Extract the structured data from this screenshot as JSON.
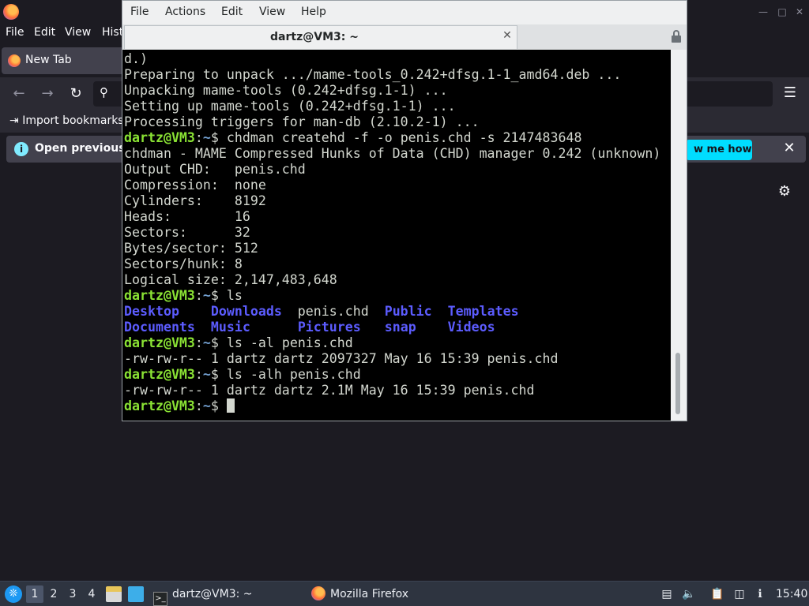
{
  "firefox": {
    "menu": [
      "File",
      "Edit",
      "View",
      "Hist"
    ],
    "tab_label": "New Tab",
    "bookmark_label": "Import bookmarks",
    "infobar_text": "Open previous",
    "infobar_button": "w me how"
  },
  "terminal": {
    "menu": [
      "File",
      "Actions",
      "Edit",
      "View",
      "Help"
    ],
    "tab_title": "dartz@VM3: ~",
    "lines": [
      [
        {
          "t": "d.)"
        }
      ],
      [
        {
          "t": "Preparing to unpack .../mame-tools_0.242+dfsg.1-1_amd64.deb ..."
        }
      ],
      [
        {
          "t": "Unpacking mame-tools (0.242+dfsg.1-1) ..."
        }
      ],
      [
        {
          "t": "Setting up mame-tools (0.242+dfsg.1-1) ..."
        }
      ],
      [
        {
          "t": "Processing triggers for man-db (2.10.2-1) ..."
        }
      ],
      [
        {
          "t": "dartz@VM3",
          "c": "prompt"
        },
        {
          "t": ":"
        },
        {
          "t": "~",
          "c": "path"
        },
        {
          "t": "$ chdman createhd -f -o penis.chd -s 2147483648"
        }
      ],
      [
        {
          "t": "chdman - MAME Compressed Hunks of Data (CHD) manager 0.242 (unknown)"
        }
      ],
      [
        {
          "t": "Output CHD:   penis.chd"
        }
      ],
      [
        {
          "t": "Compression:  none"
        }
      ],
      [
        {
          "t": "Cylinders:    8192"
        }
      ],
      [
        {
          "t": "Heads:        16"
        }
      ],
      [
        {
          "t": "Sectors:      32"
        }
      ],
      [
        {
          "t": "Bytes/sector: 512"
        }
      ],
      [
        {
          "t": "Sectors/hunk: 8"
        }
      ],
      [
        {
          "t": "Logical size: 2,147,483,648"
        }
      ],
      [
        {
          "t": "dartz@VM3",
          "c": "prompt"
        },
        {
          "t": ":"
        },
        {
          "t": "~",
          "c": "path"
        },
        {
          "t": "$ ls"
        }
      ],
      [
        {
          "t": "Desktop",
          "c": "dir"
        },
        {
          "t": "    "
        },
        {
          "t": "Downloads",
          "c": "dir"
        },
        {
          "t": "  penis.chd  "
        },
        {
          "t": "Public",
          "c": "dir"
        },
        {
          "t": "  "
        },
        {
          "t": "Templates",
          "c": "dir"
        }
      ],
      [
        {
          "t": "Documents",
          "c": "dir"
        },
        {
          "t": "  "
        },
        {
          "t": "Music",
          "c": "dir"
        },
        {
          "t": "      "
        },
        {
          "t": "Pictures",
          "c": "dir"
        },
        {
          "t": "   "
        },
        {
          "t": "snap",
          "c": "dir"
        },
        {
          "t": "    "
        },
        {
          "t": "Videos",
          "c": "dir"
        }
      ],
      [
        {
          "t": "dartz@VM3",
          "c": "prompt"
        },
        {
          "t": ":"
        },
        {
          "t": "~",
          "c": "path"
        },
        {
          "t": "$ ls -al penis.chd"
        }
      ],
      [
        {
          "t": "-rw-rw-r-- 1 dartz dartz 2097327 May 16 15:39 penis.chd"
        }
      ],
      [
        {
          "t": "dartz@VM3",
          "c": "prompt"
        },
        {
          "t": ":"
        },
        {
          "t": "~",
          "c": "path"
        },
        {
          "t": "$ ls -alh penis.chd"
        }
      ],
      [
        {
          "t": "-rw-rw-r-- 1 dartz dartz 2.1M May 16 15:39 penis.chd"
        }
      ],
      [
        {
          "t": "dartz@VM3",
          "c": "prompt"
        },
        {
          "t": ":"
        },
        {
          "t": "~",
          "c": "path"
        },
        {
          "t": "$ "
        },
        {
          "t": "",
          "c": "cursor"
        }
      ]
    ]
  },
  "taskbar": {
    "workspaces": [
      "1",
      "2",
      "3",
      "4"
    ],
    "active_workspace": "1",
    "tasks": [
      {
        "label": "dartz@VM3: ~",
        "icon": "terminal-icon"
      },
      {
        "label": "Mozilla Firefox",
        "icon": "firefox-icon"
      }
    ],
    "clock": "15:40"
  }
}
